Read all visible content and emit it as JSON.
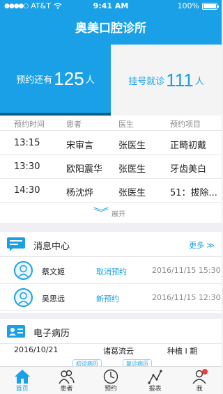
{
  "status_bar": {
    "carrier": "AT&T",
    "time": "9:41 AM",
    "battery": "100%",
    "battery_level": 1.0
  },
  "header": {
    "title": "奥美口腔诊所"
  },
  "stats": {
    "appointments": {
      "label": "预约还有",
      "value": "125",
      "unit": "人"
    },
    "walkins": {
      "label": "挂号就诊",
      "value": "111",
      "unit": "人"
    }
  },
  "appointments": {
    "columns": [
      "预约时间",
      "患者",
      "医生",
      "预约项目"
    ],
    "rows": [
      {
        "time": "13:15",
        "patient": "宋审言",
        "doctor": "张医生",
        "item": "正畸初戴"
      },
      {
        "time": "13:30",
        "patient": "欧阳震华",
        "doctor": "张医生",
        "item": "牙齿美白"
      },
      {
        "time": "14:30",
        "patient": "杨沈烨",
        "doctor": "张医生",
        "item": "51：拔除..."
      }
    ],
    "expand_label": "展开"
  },
  "messages": {
    "title": "消息中心",
    "more_label": "更多",
    "items": [
      {
        "name": "蔡文姬",
        "action": "取消预约",
        "datetime": "2016/11/15  15:30"
      },
      {
        "name": "吴思远",
        "action": "新预约",
        "datetime": "2016/11/15  12:30"
      }
    ]
  },
  "records": {
    "title": "电子病历",
    "row": {
      "date": "2016/10/21",
      "name": "诸葛流云",
      "item": "种植 I 期"
    },
    "chips": [
      "初诊病历",
      "复诊病历"
    ]
  },
  "tabbar": {
    "items": [
      {
        "label": "首页",
        "icon": "home-icon",
        "active": true
      },
      {
        "label": "患者",
        "icon": "patients-icon",
        "active": false
      },
      {
        "label": "预约",
        "icon": "clock-icon",
        "active": false
      },
      {
        "label": "报表",
        "icon": "chart-icon",
        "active": false
      },
      {
        "label": "我",
        "icon": "me-icon",
        "active": false
      }
    ]
  },
  "colors": {
    "accent": "#1aa0e6",
    "accent_dark": "#0a5f8f",
    "badge": "#f03c3c"
  }
}
